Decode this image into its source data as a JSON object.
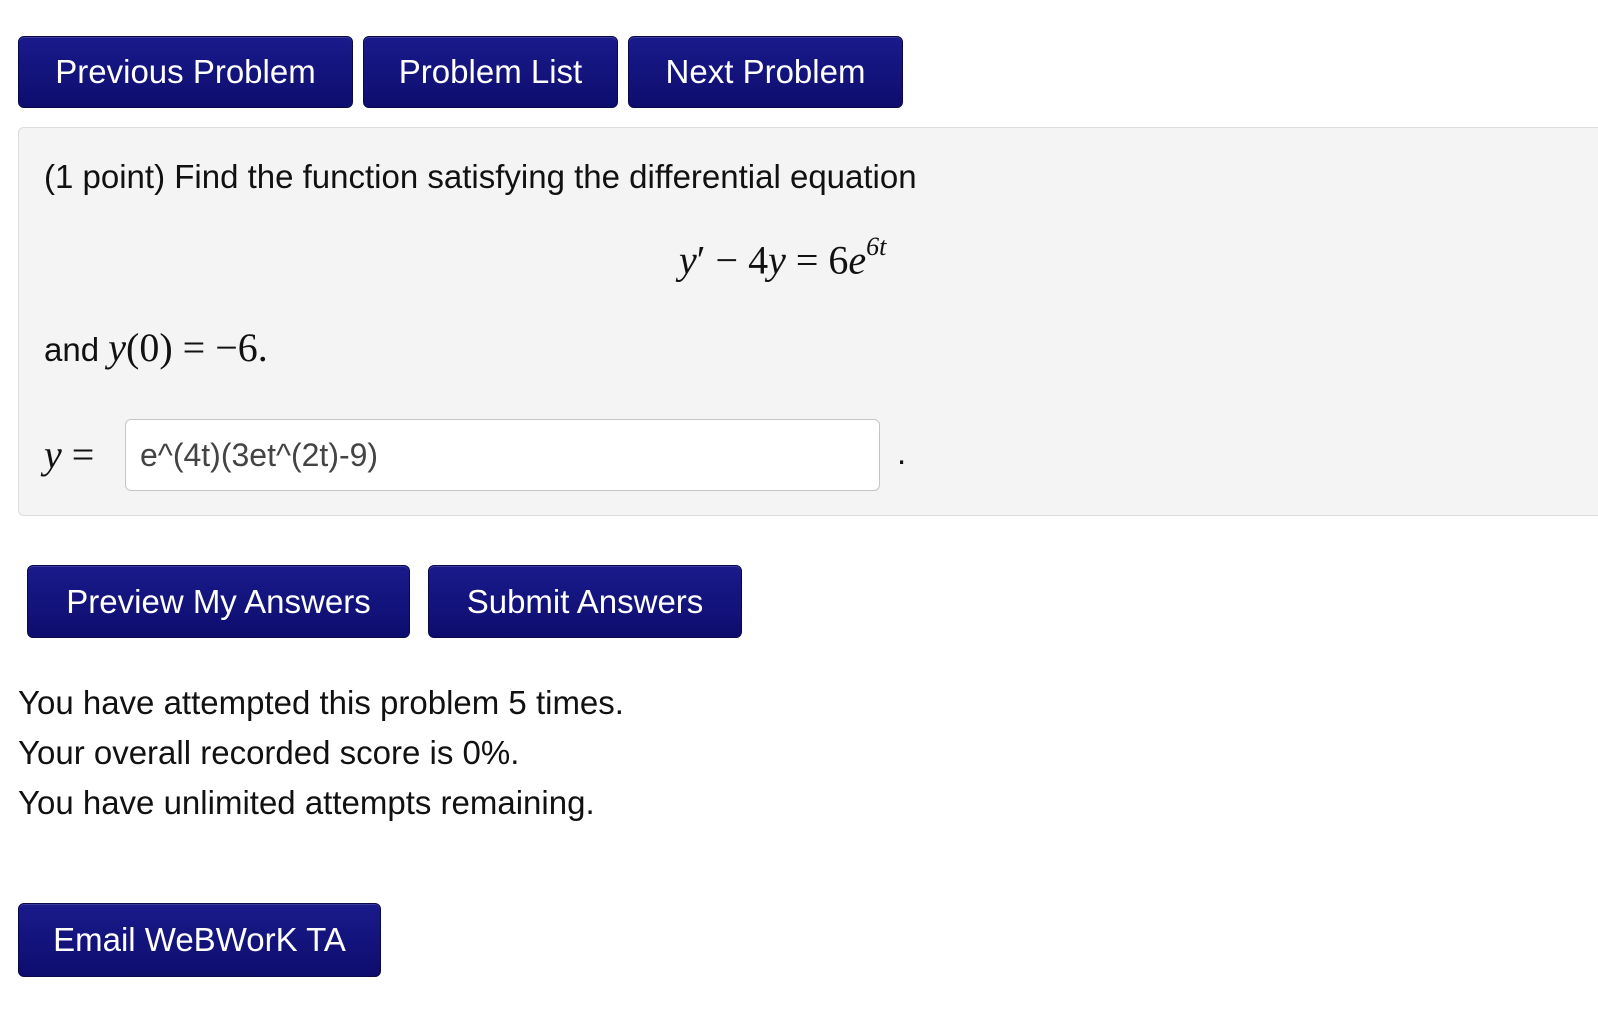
{
  "nav": {
    "previous_label": "Previous Problem",
    "list_label": "Problem List",
    "next_label": "Next Problem"
  },
  "problem": {
    "prompt": "(1 point) Find the function satisfying the differential equation",
    "equation": {
      "lhs_var": "y",
      "prime": "′",
      "minus": " − 4",
      "var2": "y",
      "equals": " = 6",
      "base": "e",
      "exponent": "6t"
    },
    "initial": {
      "prefix": "and ",
      "func": "y",
      "rest": "(0) = −6."
    },
    "answer_label_var": "y",
    "answer_label_eq": " =",
    "answer_value": "e^(4t)(3et^(2t)-9)",
    "answer_period": "."
  },
  "actions": {
    "preview_label": "Preview My Answers",
    "submit_label": "Submit Answers"
  },
  "status": {
    "attempts": "You have attempted this problem 5 times.",
    "score": "Your overall recorded score is 0%.",
    "remaining": "You have unlimited attempts remaining."
  },
  "footer": {
    "email_label": "Email WeBWorK TA"
  },
  "colors": {
    "button_bg": "#12127c",
    "panel_bg": "#f4f4f4"
  }
}
